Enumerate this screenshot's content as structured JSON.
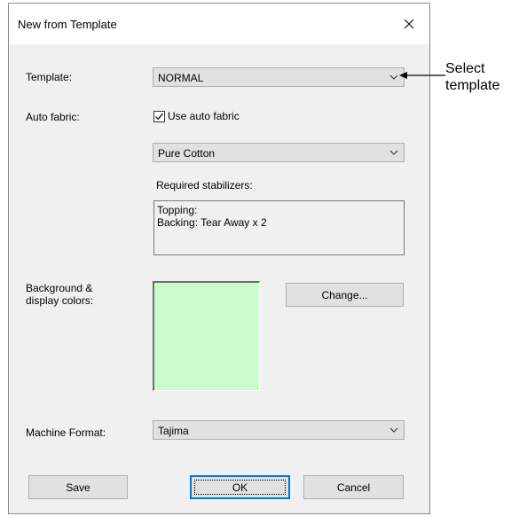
{
  "window": {
    "title": "New from Template"
  },
  "template": {
    "label": "Template:",
    "value": "NORMAL"
  },
  "auto_fabric": {
    "label": "Auto fabric:",
    "checkbox_label": "Use auto fabric",
    "checked": true,
    "fabric_value": "Pure Cotton"
  },
  "stabilizers": {
    "label": "Required stabilizers:",
    "lines": [
      "Topping:",
      "Backing: Tear Away x 2"
    ]
  },
  "background": {
    "label_line1": "Background &",
    "label_line2": "display colors:",
    "swatch_color": "#ccfccc",
    "change_button": "Change..."
  },
  "machine_format": {
    "label": "Machine Format:",
    "value": "Tajima"
  },
  "buttons": {
    "save": "Save",
    "ok": "OK",
    "cancel": "Cancel"
  },
  "annotation": {
    "line1": "Select",
    "line2": "template"
  }
}
